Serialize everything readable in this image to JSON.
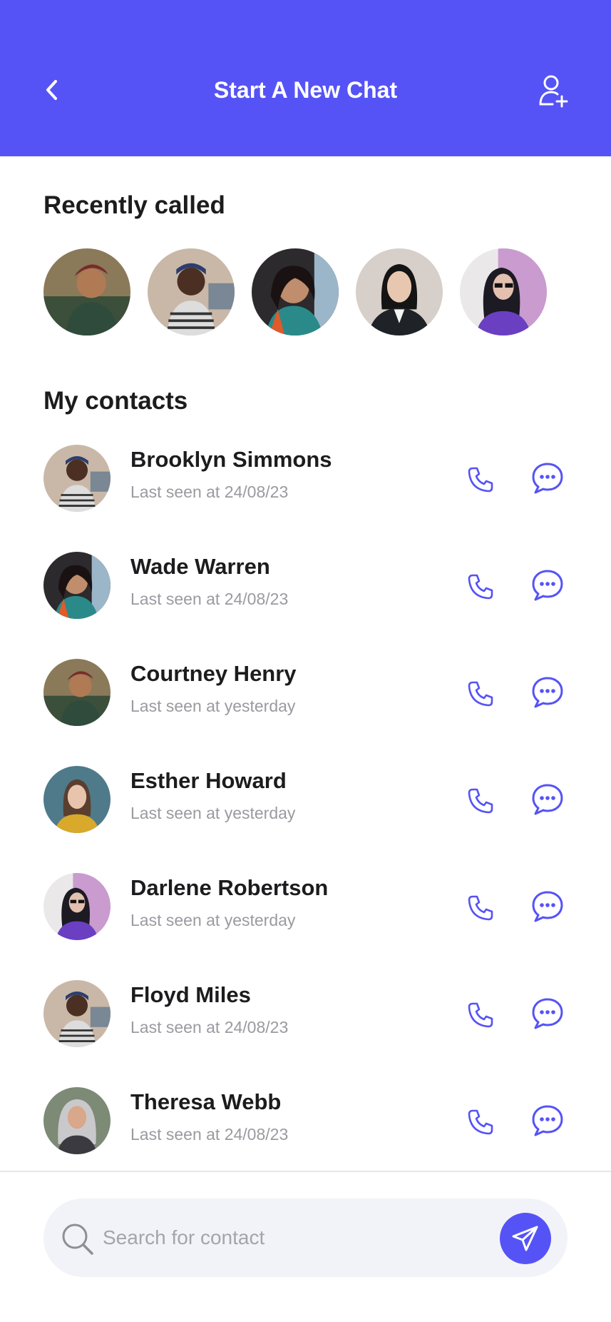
{
  "header": {
    "title": "Start A New Chat",
    "back_icon": "chevron-left-icon",
    "add_icon": "add-user-icon"
  },
  "recent": {
    "title": "Recently called",
    "avatars": [
      "avatar-1",
      "avatar-2",
      "avatar-3",
      "avatar-4",
      "avatar-5"
    ]
  },
  "contacts": {
    "title": "My contacts",
    "items": [
      {
        "name": "Brooklyn Simmons",
        "status": "Last seen at 24/08/23"
      },
      {
        "name": "Wade Warren",
        "status": "Last seen at 24/08/23"
      },
      {
        "name": "Courtney Henry",
        "status": "Last seen at yesterday"
      },
      {
        "name": "Esther Howard",
        "status": "Last seen at yesterday"
      },
      {
        "name": "Darlene Robertson",
        "status": "Last seen at yesterday"
      },
      {
        "name": "Floyd Miles",
        "status": "Last seen at 24/08/23"
      },
      {
        "name": "Theresa Webb",
        "status": "Last seen at 24/08/23"
      }
    ]
  },
  "search": {
    "placeholder": "Search for contact",
    "value": ""
  },
  "colors": {
    "primary": "#5553f6",
    "text": "#1c1c1e",
    "muted": "#9a9aa0",
    "search_bg": "#f2f3f8"
  }
}
